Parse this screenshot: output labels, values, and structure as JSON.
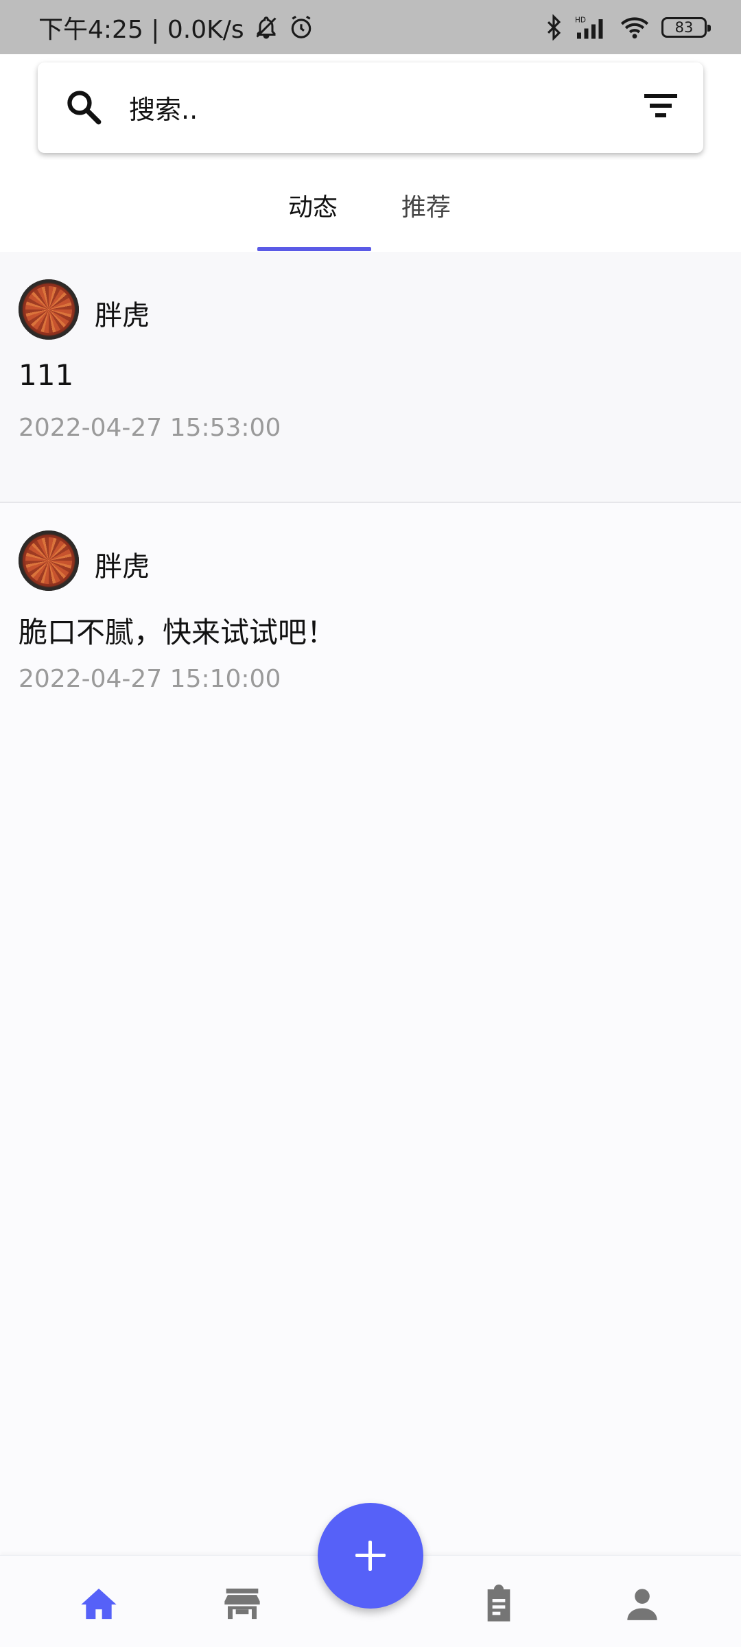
{
  "status_bar": {
    "time_network": "下午4:25 | 0.0K/s",
    "battery": "83",
    "icons": [
      "bell-off-icon",
      "alarm-icon",
      "bluetooth-icon",
      "signal-hd-icon",
      "wifi-icon",
      "battery-icon"
    ]
  },
  "search": {
    "placeholder": "搜索..",
    "search_icon": "search-icon",
    "filter_icon": "filter-icon"
  },
  "tabs": [
    {
      "label": "动态",
      "active": true
    },
    {
      "label": "推荐",
      "active": false
    }
  ],
  "posts": [
    {
      "author": "胖虎",
      "content": "111",
      "timestamp": "2022-04-27 15:53:00"
    },
    {
      "author": "胖虎",
      "content": "脆口不腻，快来试试吧！",
      "timestamp": "2022-04-27 15:10:00"
    }
  ],
  "bottom_nav": {
    "items": [
      {
        "icon": "home-icon",
        "active": true
      },
      {
        "icon": "store-icon",
        "active": false
      },
      {
        "icon": "clipboard-icon",
        "active": false
      },
      {
        "icon": "profile-icon",
        "active": false
      }
    ],
    "fab_icon": "plus-icon"
  },
  "colors": {
    "accent": "#5661f8",
    "tab_indicator": "#5a5ae6",
    "nav_inactive": "#757575",
    "timestamp": "#9a9a9a"
  }
}
